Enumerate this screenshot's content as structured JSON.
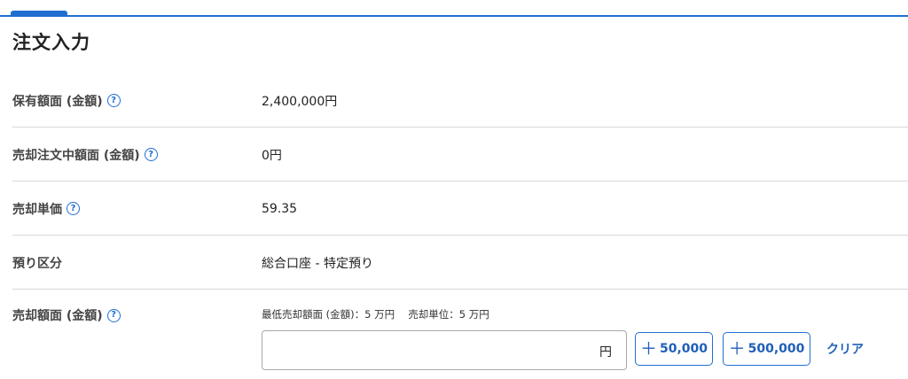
{
  "header": {
    "title": "注文入力"
  },
  "rows": [
    {
      "label": "保有額面 (金額)",
      "has_help": true,
      "value": "2,400,000円"
    },
    {
      "label": "売却注文中額面 (金額)",
      "has_help": true,
      "value": "0円"
    },
    {
      "label": "売却単価",
      "has_help": true,
      "value": "59.35"
    },
    {
      "label": "預り区分",
      "has_help": false,
      "value": "総合口座 - 特定預り"
    }
  ],
  "amount": {
    "label": "売却額面 (金額)",
    "note": "最低売却額面 (金額)：5 万円　 売却単位：5 万円",
    "input_value": "",
    "unit": "円",
    "add_50k_label": "50,000",
    "add_500k_label": "500,000",
    "clear_label": "クリア"
  },
  "icons": {
    "help": "question-circle-icon",
    "add": "plus-icon"
  },
  "colors": {
    "accent": "#1f6fd1",
    "divider": "#d8d8d8"
  }
}
